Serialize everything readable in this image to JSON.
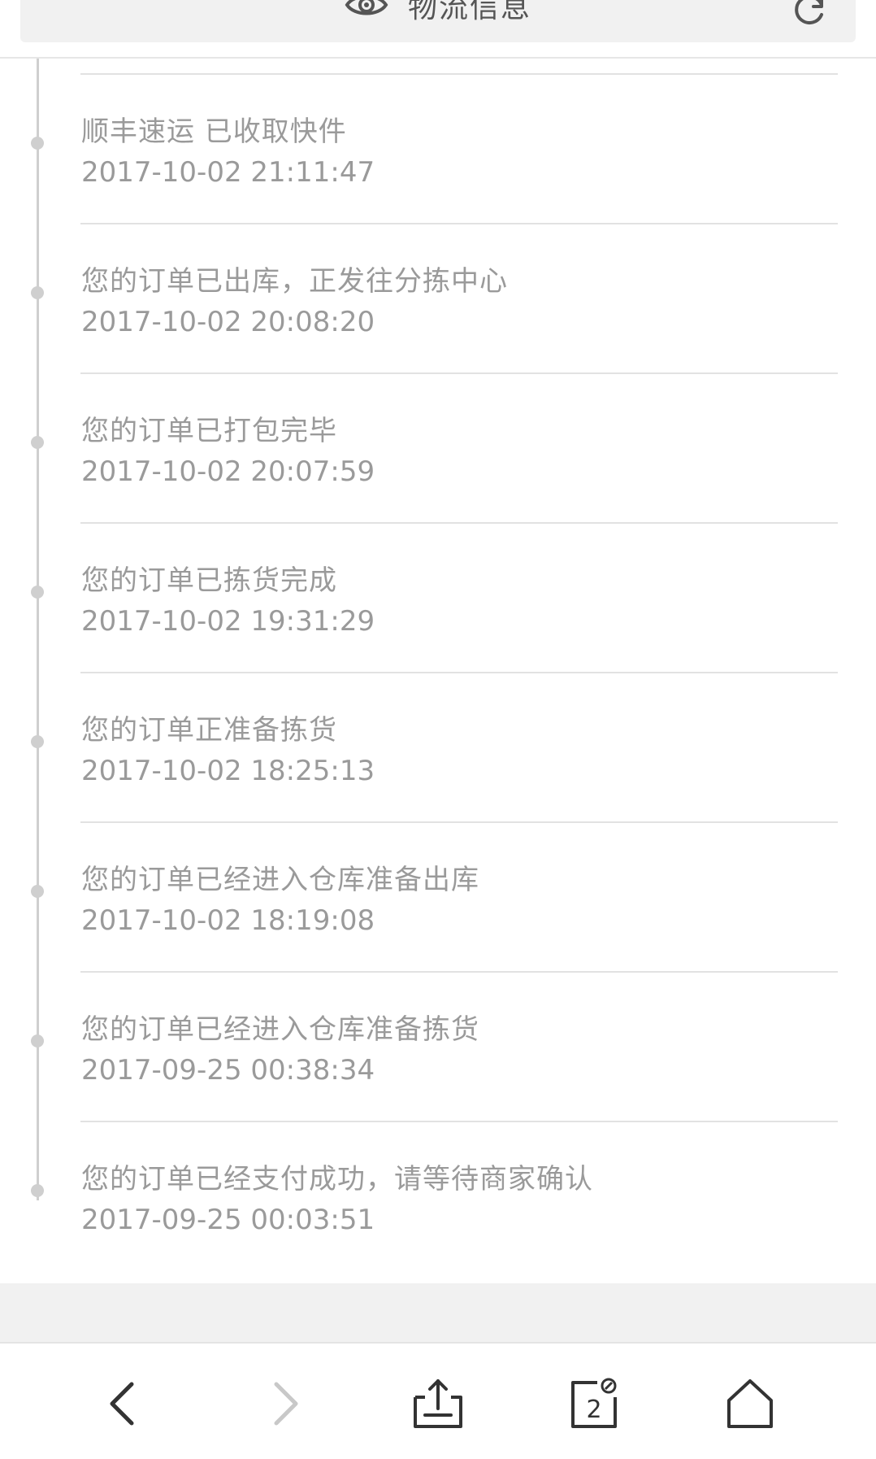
{
  "header": {
    "title": "物流信息"
  },
  "events": [
    {
      "desc": "顺丰速运 已收取快件",
      "time": "2017-10-02 21:11:47"
    },
    {
      "desc": "您的订单已出库，正发往分拣中心",
      "time": "2017-10-02 20:08:20"
    },
    {
      "desc": "您的订单已打包完毕",
      "time": "2017-10-02 20:07:59"
    },
    {
      "desc": "您的订单已拣货完成",
      "time": "2017-10-02 19:31:29"
    },
    {
      "desc": "您的订单正准备拣货",
      "time": "2017-10-02 18:25:13"
    },
    {
      "desc": "您的订单已经进入仓库准备出库",
      "time": "2017-10-02 18:19:08"
    },
    {
      "desc": "您的订单已经进入仓库准备拣货",
      "time": "2017-09-25 00:38:34"
    },
    {
      "desc": "您的订单已经支付成功，请等待商家确认",
      "time": "2017-09-25 00:03:51"
    }
  ],
  "toolbar": {
    "tabs_count": "2"
  },
  "icons": {
    "header_left": "eye-icon",
    "header_right": "refresh-icon",
    "back": "chevron-left-icon",
    "forward": "chevron-right-icon",
    "share": "share-icon",
    "tabs": "tabs-icon",
    "home": "home-icon"
  },
  "colors": {
    "text": "#9a9a9a",
    "header_bg": "#f1f1f1",
    "timeline": "#cfcfcf"
  }
}
